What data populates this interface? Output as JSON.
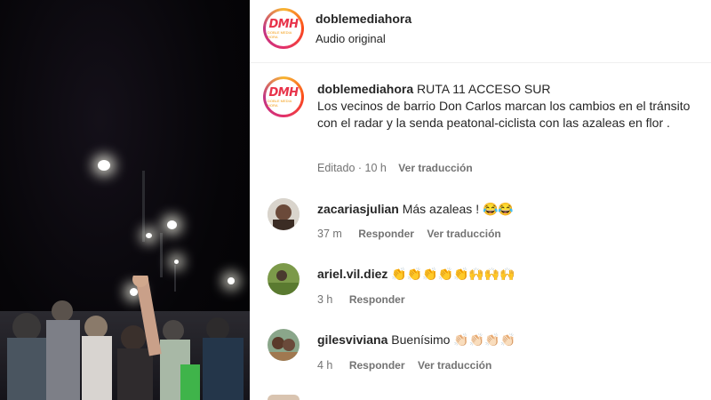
{
  "header": {
    "username": "doblemediahora",
    "subtitle": "Audio original",
    "avatar_text": "DMH",
    "avatar_subtext": "DOBLE MEDIA HORA"
  },
  "post": {
    "username": "doblemediahora",
    "caption_title": "RUTA 11 ACCESO SUR",
    "caption_body": "Los vecinos de barrio Don Carlos marcan los cambios en el tránsito con el radar y la senda peatonal-ciclista con las azaleas en flor .",
    "edited": "Editado · 10 h",
    "translate": "Ver traducción"
  },
  "comments": [
    {
      "username": "zacariasjulian",
      "text": "Más azaleas ! 😂😂",
      "time": "37 m",
      "reply": "Responder",
      "translate": "Ver traducción"
    },
    {
      "username": "ariel.vil.diez",
      "text": "👏👏👏👏👏🙌🙌🙌",
      "time": "3 h",
      "reply": "Responder",
      "translate": ""
    },
    {
      "username": "gilesviviana",
      "text": "Buenísimo 👏🏻👏🏻👏🏻👏🏻",
      "time": "4 h",
      "reply": "Responder",
      "translate": "Ver traducción"
    }
  ],
  "colors": {
    "accent": "#e8334a",
    "muted": "#737373",
    "text": "#262626"
  }
}
